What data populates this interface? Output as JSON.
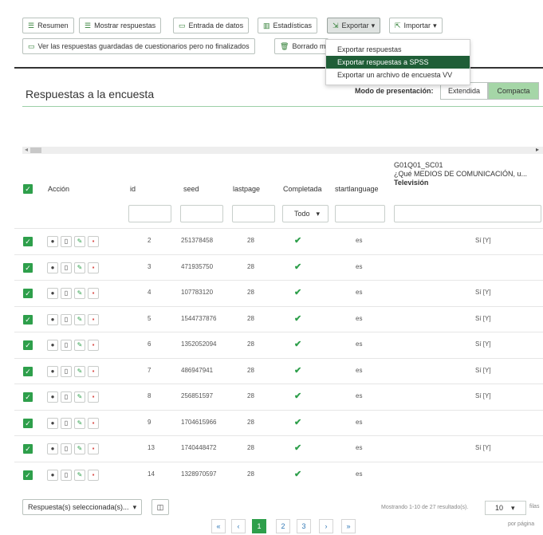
{
  "toolbar": {
    "resumen": "Resumen",
    "mostrar": "Mostrar respuestas",
    "entrada": "Entrada de datos",
    "estadisticas": "Estadísticas",
    "exportar": "Exportar",
    "importar": "Importar",
    "guardadas": "Ver las respuestas guardadas de cuestionarios pero no finalizados",
    "borrado": "Borrado ma"
  },
  "export_menu": {
    "items": [
      "Exportar respuestas",
      "Exportar respuestas a SPSS",
      "Exportar un archivo de encuesta VV"
    ]
  },
  "panel": {
    "title": "Respuestas a la encuesta",
    "mode_label": "Modo de presentación:",
    "mode_extended": "Extendida",
    "mode_compact": "Compacta"
  },
  "table": {
    "headers": {
      "accion": "Acción",
      "id": "id",
      "seed": "seed",
      "lastpage": "lastpage",
      "completada": "Completada",
      "startlanguage": "startlanguage",
      "q_code": "G01Q01_SC01",
      "q_text": "¿Qué MEDIOS DE COMUNICACIÓN, u...",
      "q_sub": "Televisión"
    },
    "filter_select": "Todo",
    "rows": [
      {
        "id": "2",
        "seed": "251378458",
        "lastpage": "28",
        "lang": "es",
        "tv": "Sí [Y]"
      },
      {
        "id": "3",
        "seed": "471935750",
        "lastpage": "28",
        "lang": "es",
        "tv": ""
      },
      {
        "id": "4",
        "seed": "107783120",
        "lastpage": "28",
        "lang": "es",
        "tv": "Sí [Y]"
      },
      {
        "id": "5",
        "seed": "1544737876",
        "lastpage": "28",
        "lang": "es",
        "tv": "Sí [Y]"
      },
      {
        "id": "6",
        "seed": "1352052094",
        "lastpage": "28",
        "lang": "es",
        "tv": "Sí [Y]"
      },
      {
        "id": "7",
        "seed": "486947941",
        "lastpage": "28",
        "lang": "es",
        "tv": "Sí [Y]"
      },
      {
        "id": "8",
        "seed": "256851597",
        "lastpage": "28",
        "lang": "es",
        "tv": "Sí [Y]"
      },
      {
        "id": "9",
        "seed": "1704615966",
        "lastpage": "28",
        "lang": "es",
        "tv": ""
      },
      {
        "id": "13",
        "seed": "1740448472",
        "lastpage": "28",
        "lang": "es",
        "tv": "Sí [Y]"
      },
      {
        "id": "14",
        "seed": "1328970597",
        "lastpage": "28",
        "lang": "es",
        "tv": ""
      }
    ]
  },
  "footer": {
    "selected": "Respuesta(s) seleccionada(s)...",
    "showing": "Mostrando 1-10 de 27 resultado(s).",
    "page_size": "10",
    "filas": "filas",
    "por_pagina": "por página",
    "pages": [
      "1",
      "2",
      "3"
    ],
    "first": "«",
    "prev": "‹",
    "next": "›",
    "last": "»"
  },
  "colors": {
    "accent": "#2e9f4b",
    "menu_highlight": "#1f5e37"
  }
}
